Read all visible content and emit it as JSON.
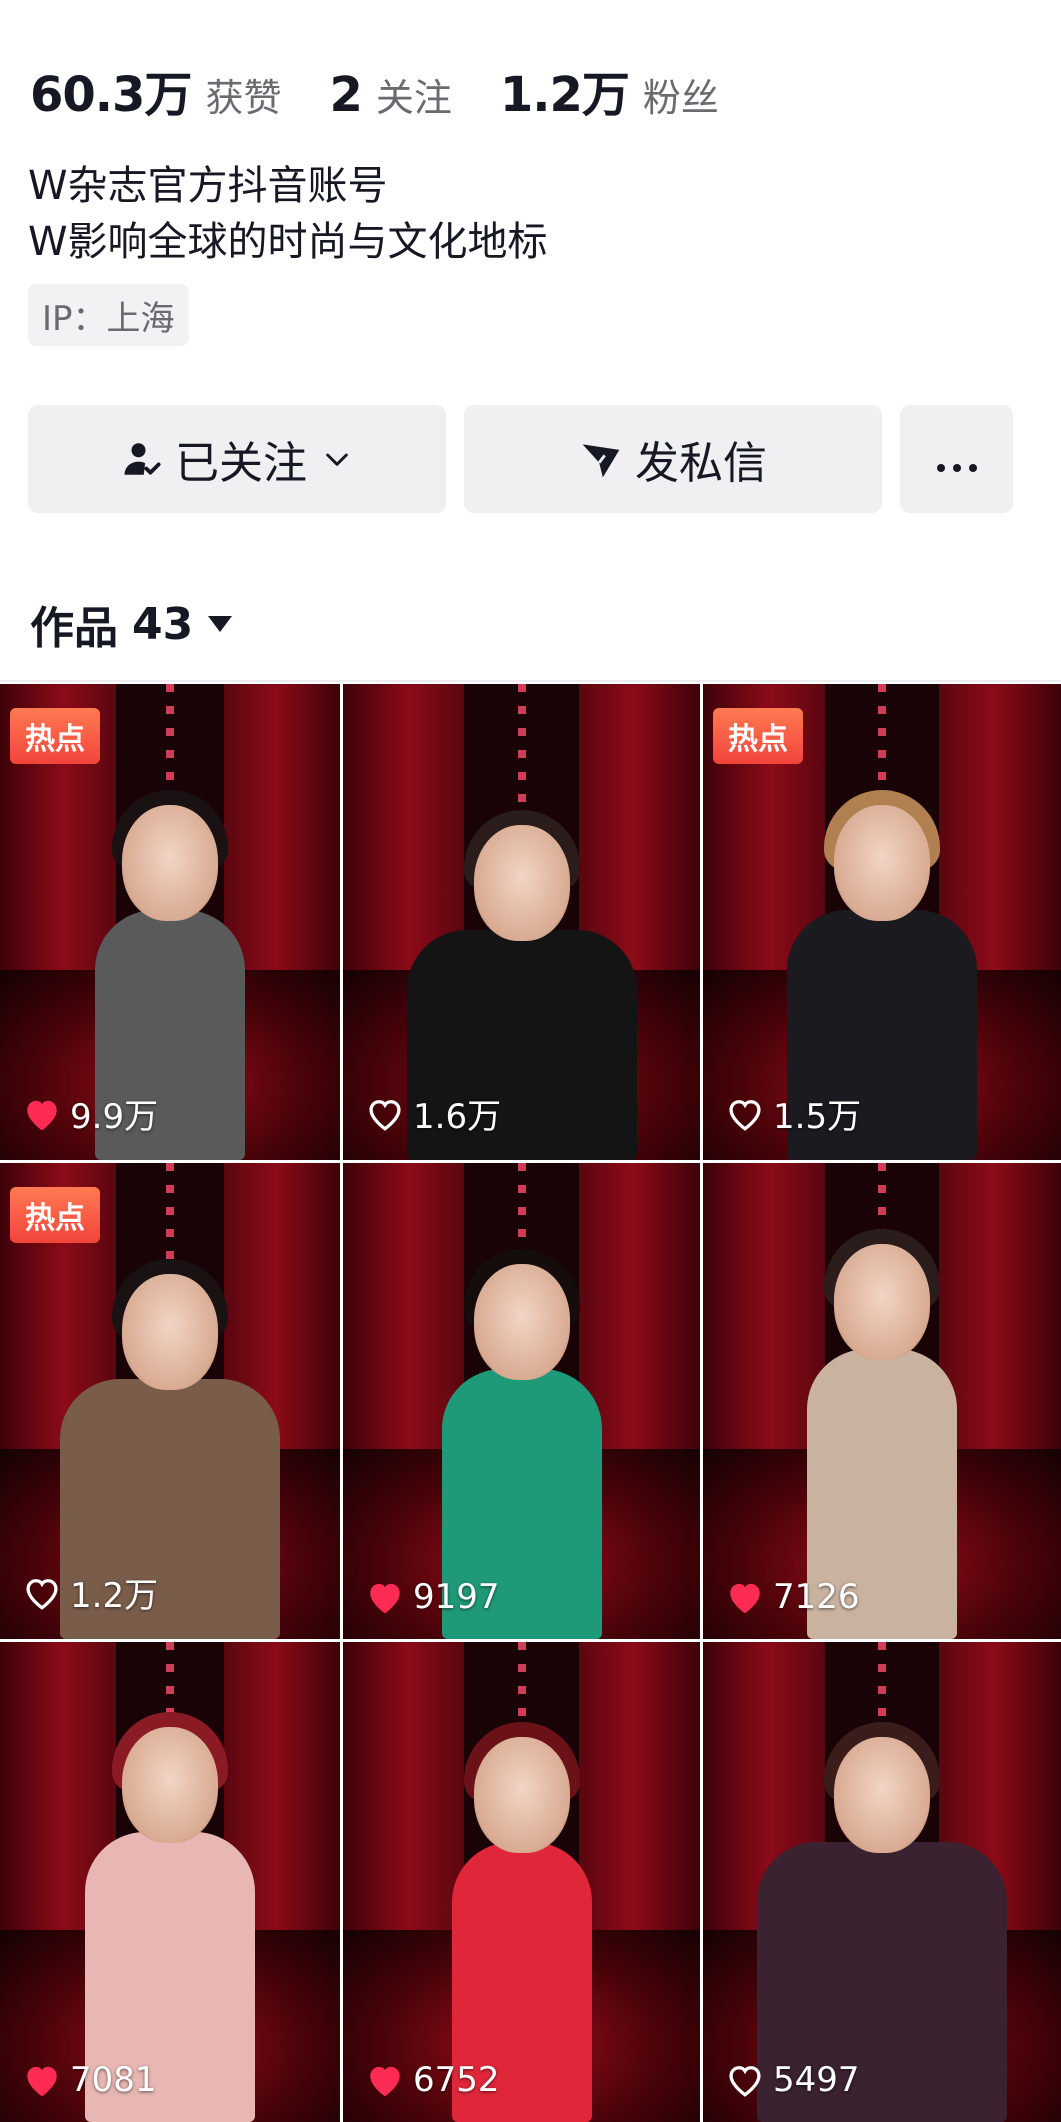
{
  "stats": [
    {
      "num": "60.3万",
      "label": "获赞"
    },
    {
      "num": "2",
      "label": "关注"
    },
    {
      "num": "1.2万",
      "label": "粉丝"
    }
  ],
  "bio": {
    "line1": "W杂志官方抖音账号",
    "line2": "W影响全球的时尚与文化地标"
  },
  "ip_tag": "IP：上海",
  "buttons": {
    "follow_label": "已关注",
    "message_label": "发私信",
    "more_icon": "more-dots-icon"
  },
  "works": {
    "label": "作品",
    "count": "43"
  },
  "colors": {
    "hot_badge": "#f2443a",
    "liked_heart": "#fe2c55",
    "button_bg": "#f0f0f2"
  },
  "videos": [
    {
      "hot": "热点",
      "likes": "9.9万",
      "liked": true
    },
    {
      "hot": "",
      "likes": "1.6万",
      "liked": false
    },
    {
      "hot": "热点",
      "likes": "1.5万",
      "liked": false
    },
    {
      "hot": "热点",
      "likes": "1.2万",
      "liked": false
    },
    {
      "hot": "",
      "likes": "9197",
      "liked": true
    },
    {
      "hot": "",
      "likes": "7126",
      "liked": true
    },
    {
      "hot": "",
      "likes": "7081",
      "liked": true
    },
    {
      "hot": "",
      "likes": "6752",
      "liked": true
    },
    {
      "hot": "",
      "likes": "5497",
      "liked": false
    }
  ]
}
